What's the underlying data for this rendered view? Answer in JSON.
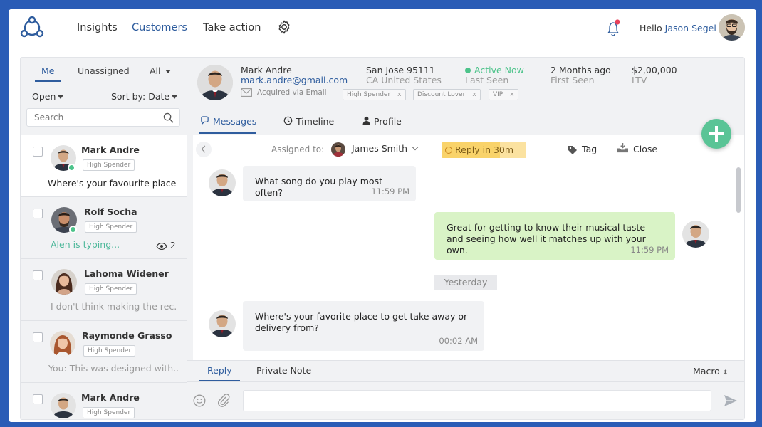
{
  "topnav": {
    "items": [
      {
        "label": "Insights"
      },
      {
        "label": "Customers"
      },
      {
        "label": "Take action"
      }
    ],
    "hello_prefix": "Hello",
    "user_name": "Jason Segel"
  },
  "sidebar": {
    "tabs": [
      {
        "label": "Me"
      },
      {
        "label": "Unassigned"
      },
      {
        "label": "All"
      }
    ],
    "status_filter": "Open",
    "sort_label": "Sort by: Date",
    "search_placeholder": "Search",
    "conversations": [
      {
        "name": "Mark Andre",
        "tag": "High Spender",
        "preview": "Where's your favourite place to get take away",
        "online": true,
        "selected": true
      },
      {
        "name": "Rolf Socha",
        "tag": "High Spender",
        "preview": "Alen is typing...",
        "online": true,
        "viewers": "2"
      },
      {
        "name": "Lahoma Widener",
        "tag": "High Spender",
        "preview": "I don't think making the rec..."
      },
      {
        "name": "Raymonde Grasso",
        "tag": "High Spender",
        "preview": "You: This was designed with..."
      },
      {
        "name": "Mark Andre",
        "tag": "High Spender"
      }
    ]
  },
  "customer": {
    "name": "Mark Andre",
    "email": "mark.andre@gmail.com",
    "acquired": "Acquired via Email",
    "location_city": "San Jose 95111",
    "location_country": "CA United States",
    "status": "Active Now",
    "status_label": "Last Seen",
    "first_seen_value": "2 Months ago",
    "first_seen_label": "First Seen",
    "ltv_value": "$2,00,000",
    "ltv_label": "LTV",
    "tags": [
      {
        "label": "High Spender",
        "remove": "x"
      },
      {
        "label": "Discount Lover",
        "remove": "x"
      },
      {
        "label": "VIP",
        "remove": "x"
      }
    ]
  },
  "tabs": [
    {
      "label": "Messages"
    },
    {
      "label": "Timeline"
    },
    {
      "label": "Profile"
    }
  ],
  "toolbar": {
    "assigned_label": "Assigned to:",
    "assignee": "James Smith",
    "reply_in": "Reply in 30m",
    "tag_label": "Tag",
    "close_label": "Close"
  },
  "messages": [
    {
      "direction": "in",
      "text": "What song do you play most often?",
      "time": "11:59 PM"
    },
    {
      "direction": "out",
      "text": "Great for getting to know their musical taste and seeing how well it matches up with your own.",
      "time": "11:59 PM"
    },
    {
      "direction": "in",
      "text": "Where's your favorite place to get take away or delivery from?",
      "time": "00:02 AM"
    }
  ],
  "day_separator": "Yesterday",
  "composer": {
    "tabs": [
      {
        "label": "Reply"
      },
      {
        "label": "Private Note"
      }
    ],
    "macro_label": "Macro",
    "macro_arrows": "⬍",
    "input_value": "",
    "input_placeholder": ""
  },
  "colors": {
    "background": "#2a5cb6",
    "accent": "#2f5d9e",
    "online": "#4cc38a",
    "fab": "#5ac496",
    "outgoing_bubble": "#d9f3c6",
    "reply_in": "#f9d36a"
  }
}
